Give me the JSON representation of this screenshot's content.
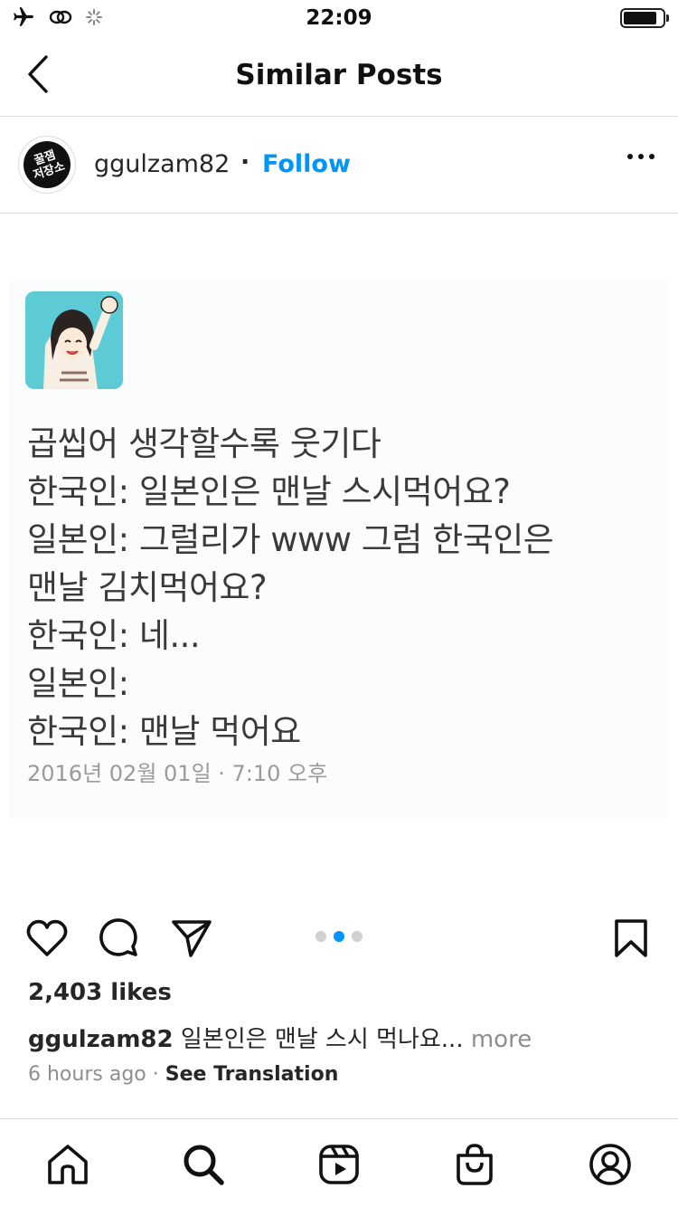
{
  "status_bar": {
    "time": "22:09",
    "icons": [
      "airplane-icon",
      "link-icon",
      "loading-spinner-icon"
    ],
    "battery_level": 0.85
  },
  "header": {
    "title": "Similar Posts",
    "back_icon": "chevron-left-icon"
  },
  "post": {
    "username": "ggulzam82",
    "separator": "·",
    "follow_label": "Follow",
    "avatar_text": "꿀잼\n저장소",
    "more_icon": "ellipsis-icon",
    "image": {
      "lines": [
        "곱씹어 생각할수록 웃기다",
        "한국인: 일본인은 맨날 스시먹어요?",
        "일본인: 그럴리가 www 그럼 한국인은",
        "맨날 김치먹어요?",
        "한국인: 네...",
        "일본인:",
        "한국인: 맨날 먹어요"
      ],
      "date": "2016년 02월 01일 · 7:10 오후",
      "avatar_color": "#5ccbd6"
    },
    "carousel": {
      "count": 3,
      "active_index": 1
    },
    "likes": "2,403 likes",
    "caption_user": "ggulzam82",
    "caption_text": "일본인은 맨날 스시 먹나요...",
    "caption_more": "more",
    "time_ago": "6 hours ago",
    "meta_separator": "·",
    "see_translation": "See Translation"
  },
  "actions": [
    "heart-icon",
    "comment-icon",
    "share-icon",
    "bookmark-icon"
  ],
  "tab_bar": [
    "home-icon",
    "search-icon",
    "reels-icon",
    "shop-icon",
    "profile-icon"
  ],
  "colors": {
    "accent": "#0095f6",
    "text": "#262626",
    "muted": "#8e8e8e",
    "divider": "#dbdbdb"
  }
}
